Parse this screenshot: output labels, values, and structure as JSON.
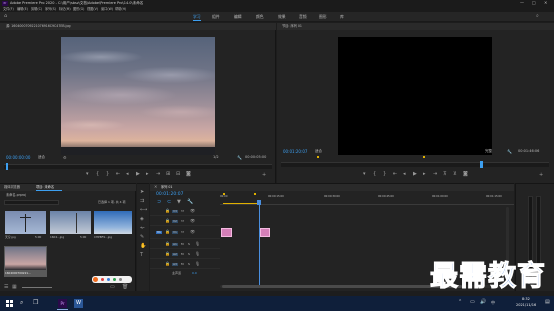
{
  "app": {
    "title": "Adobe Premiere Pro 2020 - C:\\用户\\sbsz\\文档\\Adobe\\Premiere Pro\\14.0\\未命名"
  },
  "window_controls": [
    "—",
    "□",
    "✕"
  ],
  "menu": [
    "文件(F)",
    "编辑(E)",
    "剪辑(C)",
    "序列(S)",
    "标记(M)",
    "图形(G)",
    "视图(V)",
    "窗口(W)",
    "帮助(H)"
  ],
  "workspaces": {
    "active": "学习",
    "items": [
      "学习",
      "组件",
      "编辑",
      "颜色",
      "效果",
      "音频",
      "图形",
      "库"
    ]
  },
  "source": {
    "title": "源: 1604000709221076916C9C47EB.jpg",
    "timecode": "00:00:00:00",
    "fit": "适合",
    "ratio": "1/2",
    "duration": "00:00:05:00"
  },
  "program": {
    "title": "节目: 序列 01",
    "timecode": "00:01:20:07",
    "fit": "适合",
    "ratio": "完整",
    "duration": "00:01:46:06"
  },
  "project": {
    "tabs": [
      "项目: 未命名",
      "媒体浏览器",
      "库"
    ],
    "path": "未命名.prproj",
    "count": "已选择 1 项, 共 4 项",
    "items": [
      {
        "name": "天空.jpg",
        "dur": "5:00"
      },
      {
        "name": "1604...jpg",
        "dur": "5:00"
      },
      {
        "name": "CHPBF9...jpg",
        "dur": "5:00"
      },
      {
        "name": "1604000709221...",
        "dur": "5:00"
      }
    ]
  },
  "timeline": {
    "title": "序列 01",
    "timecode": "00:01:20:07",
    "ruler": [
      "00:00",
      "00:00:15:00",
      "00:00:30:00",
      "00:00:45:00",
      "00:01:00:00",
      "00:01:15:00",
      "00:01:30:00"
    ],
    "video_tracks": [
      "V3",
      "V2",
      "V1"
    ],
    "audio_tracks": [
      "A1",
      "A2",
      "A3"
    ],
    "master": "主声道",
    "master_value": "0.0"
  },
  "taskbar": {
    "time": "8:32",
    "date": "2021/11/16",
    "lang": "中"
  },
  "watermark": "最需教育",
  "colors": {
    "accent": "#3d9ff0",
    "clip_pink": "#d47fb8",
    "playhead": "#4a8fdf",
    "taskbar": "#0f1f3a",
    "watermark": "#1a5fd0"
  }
}
